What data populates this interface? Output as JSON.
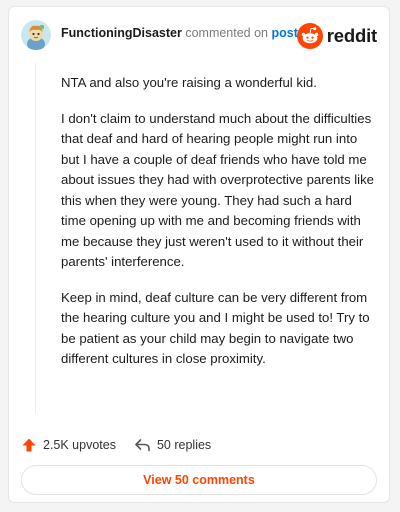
{
  "header": {
    "username": "FunctioningDisaster",
    "action_text": "commented on",
    "link_text": "post",
    "brand_wordmark": "reddit"
  },
  "comment": {
    "paragraphs": [
      "NTA and also you're raising a wonderful kid.",
      "I don't claim to understand much about the difficulties that deaf and hard of hearing people might run into but I have a couple of deaf friends who have told me about issues they had with overprotective parents like this when they were young. They had such a hard time opening up with me and becoming friends with me because they just weren't used to it without their parents' interference.",
      "Keep in mind, deaf culture can be very different from the hearing culture you and I might be used to! Try to be patient as your child may begin to navigate two different cultures in close proximity."
    ]
  },
  "actions": {
    "upvotes_label": "2.5K upvotes",
    "replies_label": "50 replies",
    "upvote_icon": "upvote-arrow-icon",
    "reply_icon": "reply-arrow-icon"
  },
  "footer": {
    "view_comments_label": "View 50 comments"
  },
  "colors": {
    "brand_orange": "#ff4500",
    "link_blue": "#0079d3",
    "upvote_orange": "#ff4500"
  }
}
